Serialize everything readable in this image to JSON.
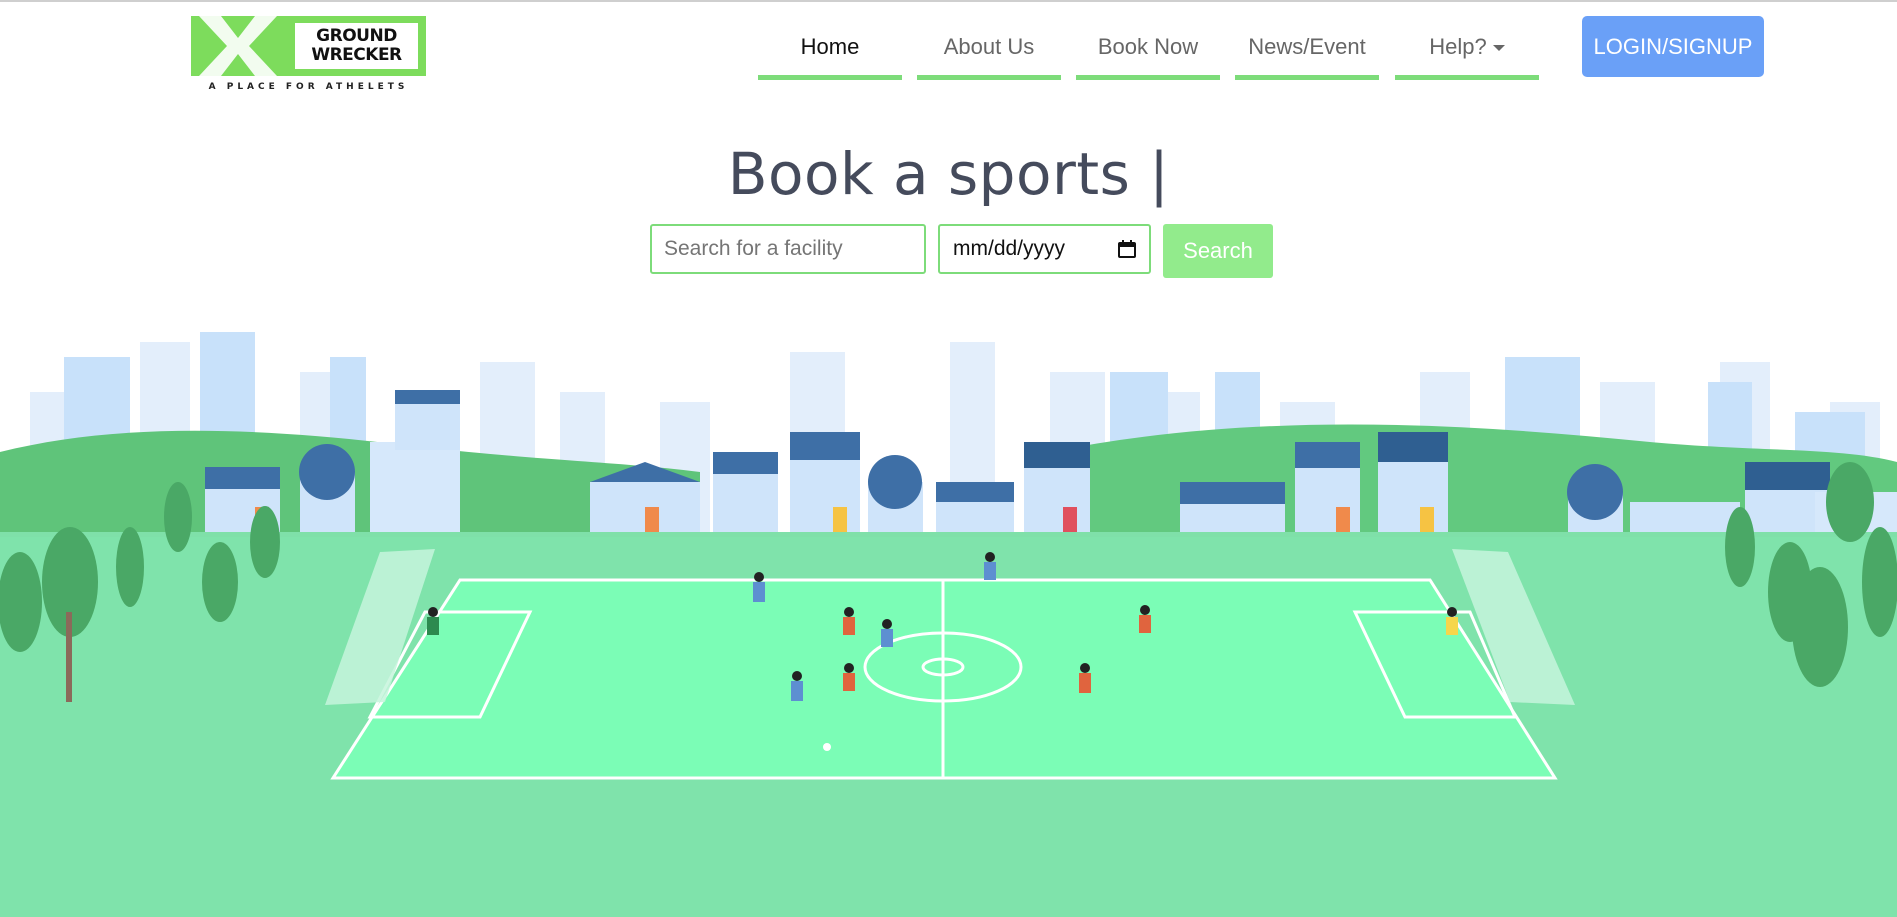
{
  "brand": {
    "logo_line1": "GROUND",
    "logo_line2": "WRECKER",
    "tagline": "A PLACE FOR ATHELETS",
    "color": "#7ddc5c"
  },
  "nav": {
    "items": [
      {
        "label": "Home",
        "active": true
      },
      {
        "label": "About Us",
        "active": false
      },
      {
        "label": "Book Now",
        "active": false
      },
      {
        "label": "News/Event",
        "active": false
      },
      {
        "label": "Help?",
        "active": false,
        "dropdown": true
      }
    ],
    "underline_color": "#7ddc7a",
    "login_label": "LOGIN/SIGNUP",
    "login_color": "#6aa0f7"
  },
  "hero": {
    "headline": "Book a sports |",
    "search_placeholder": "Search for a facility",
    "date_placeholder": "mm/dd/yyyy",
    "search_label": "Search",
    "search_color": "#92eb8c"
  },
  "illustration": {
    "subject": "soccer-field-city-scene",
    "icons": [
      "calendar-icon",
      "dropdown-caret-icon"
    ]
  }
}
